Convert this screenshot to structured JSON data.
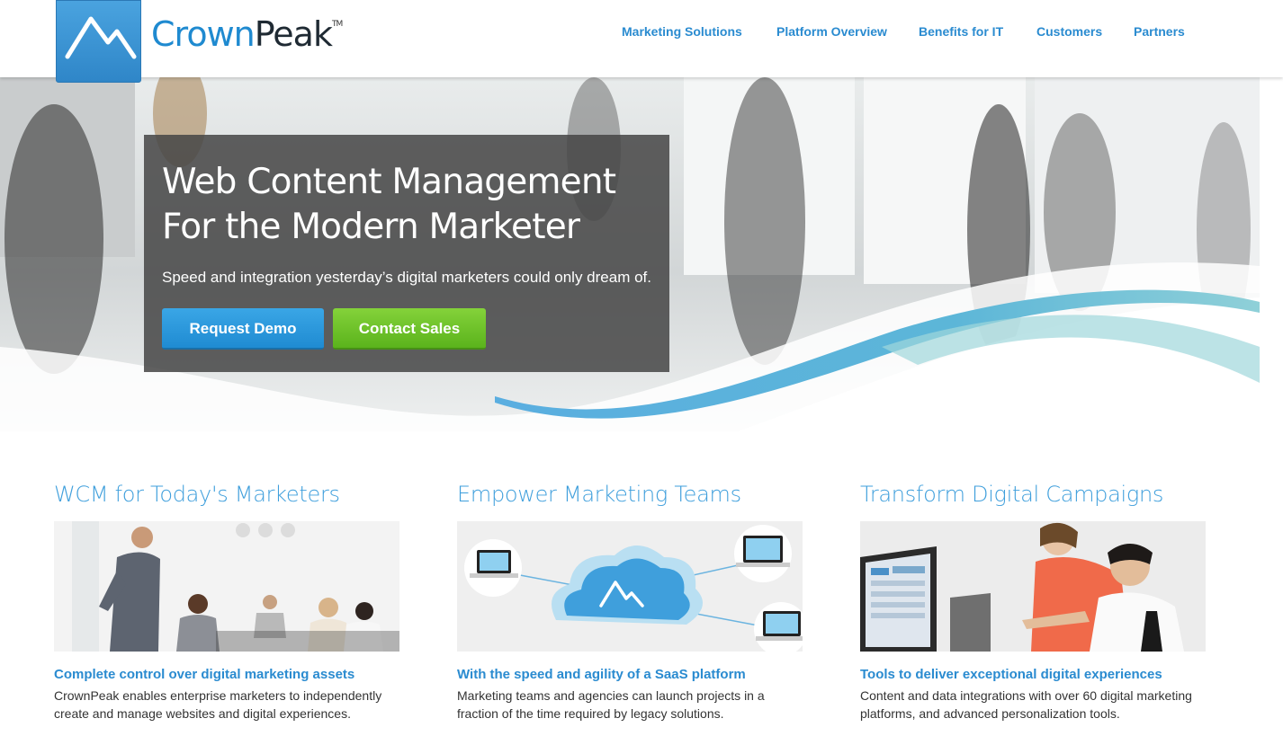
{
  "brand": {
    "name_part1": "Crown",
    "name_part2": "Peak",
    "trademark": "TM",
    "primary_color": "#2a8bd0"
  },
  "nav": {
    "items": [
      {
        "label": "Marketing Solutions"
      },
      {
        "label": "Platform Overview"
      },
      {
        "label": "Benefits for IT"
      },
      {
        "label": "Customers"
      },
      {
        "label": "Partners"
      }
    ]
  },
  "hero": {
    "title": "Web Content Management For the Modern Marketer",
    "subtitle": "Speed and integration yesterday’s digital marketers could only dream of.",
    "primary_button": "Request Demo",
    "secondary_button": "Contact Sales",
    "primary_button_color": "#2a9ae0",
    "secondary_button_color": "#6cc226"
  },
  "columns": [
    {
      "heading": "WCM for Today's Marketers",
      "subheading": "Complete control over digital marketing assets",
      "description": "CrownPeak enables enterprise marketers to independently create and manage websites and digital experiences."
    },
    {
      "heading": "Empower Marketing Teams",
      "subheading": "With the speed and agility of a SaaS platform",
      "description": "Marketing teams and agencies can launch projects in a fraction of the time required by legacy solutions."
    },
    {
      "heading": "Transform Digital Campaigns",
      "subheading": "Tools to deliver exceptional digital experiences",
      "description": "Content and data integrations with over 60 digital marketing platforms, and advanced personalization tools."
    }
  ]
}
